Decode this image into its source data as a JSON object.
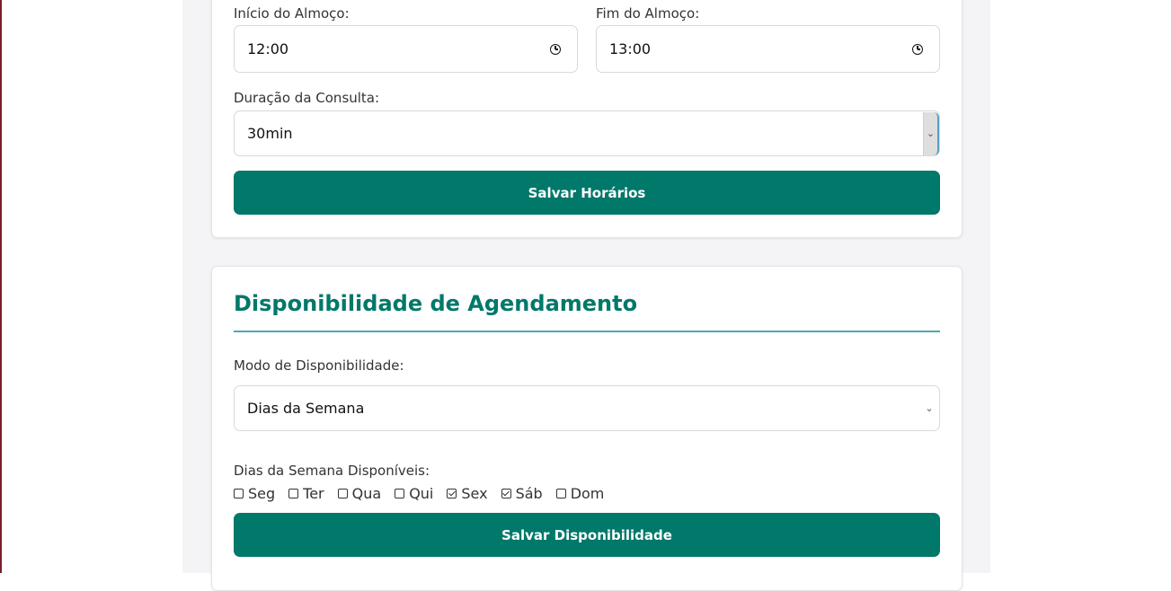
{
  "schedule": {
    "lunch_start_label": "Início do Almoço:",
    "lunch_start_value": "12:00",
    "lunch_end_label": "Fim do Almoço:",
    "lunch_end_value": "13:00",
    "duration_label": "Duração da Consulta:",
    "duration_value": "30min",
    "save_label": "Salvar Horários"
  },
  "availability": {
    "title": "Disponibilidade de Agendamento",
    "mode_label": "Modo de Disponibilidade:",
    "mode_value": "Dias da Semana",
    "days_label": "Dias da Semana Disponíveis:",
    "days": [
      {
        "label": "Seg",
        "checked": false
      },
      {
        "label": "Ter",
        "checked": false
      },
      {
        "label": "Qua",
        "checked": false
      },
      {
        "label": "Qui",
        "checked": false
      },
      {
        "label": "Sex",
        "checked": true
      },
      {
        "label": "Sáb",
        "checked": true
      },
      {
        "label": "Dom",
        "checked": false
      }
    ],
    "save_label": "Salvar Disponibilidade"
  },
  "icons": {
    "time": "clock-icon",
    "dropdown": "chevron-down-icon"
  },
  "colors": {
    "accent": "#00786a",
    "rule": "#4aa9b0"
  }
}
